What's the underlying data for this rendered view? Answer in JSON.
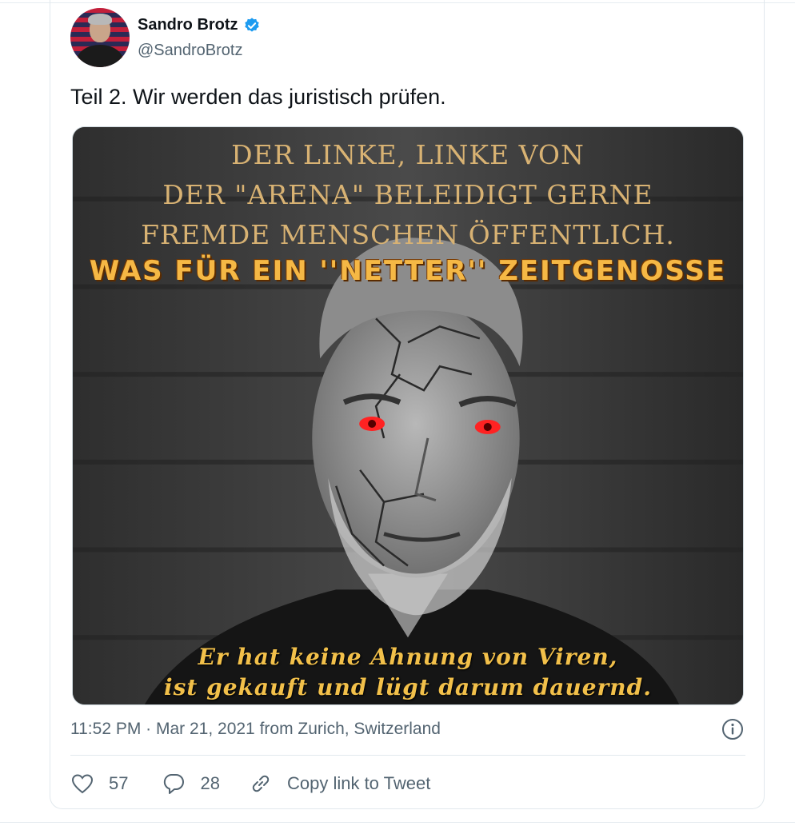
{
  "tweet": {
    "author_name": "Sandro Brotz",
    "author_handle": "@SandroBrotz",
    "text": "Teil 2. Wir werden das juristisch prüfen.",
    "meta": "11:52 PM · Mar 21, 2021 from Zurich, Switzerland"
  },
  "image_overlay": {
    "top_lines": [
      "DER LINKE, LINKE VON",
      "DER \"ARENA\" BELEIDIGT GERNE",
      "FREMDE MENSCHEN ÖFFENTLICH."
    ],
    "headline": "WAS FÜR EIN ''NETTER'' ZEITGENOSSE",
    "bottom_lines": [
      "Er hat keine Ahnung von Viren,",
      "ist gekauft und lügt darum dauernd."
    ]
  },
  "actions": {
    "like_count": "57",
    "reply_count": "28",
    "copy_label": "Copy link to Tweet"
  },
  "colors": {
    "verified": "#1d9bf0",
    "secondary_text": "#536471",
    "overlay_gold": "#d8b273",
    "headline_orange": "#f5b845"
  },
  "icons": [
    "verified-badge-icon",
    "info-icon",
    "heart-icon",
    "reply-bubble-icon",
    "link-icon"
  ]
}
